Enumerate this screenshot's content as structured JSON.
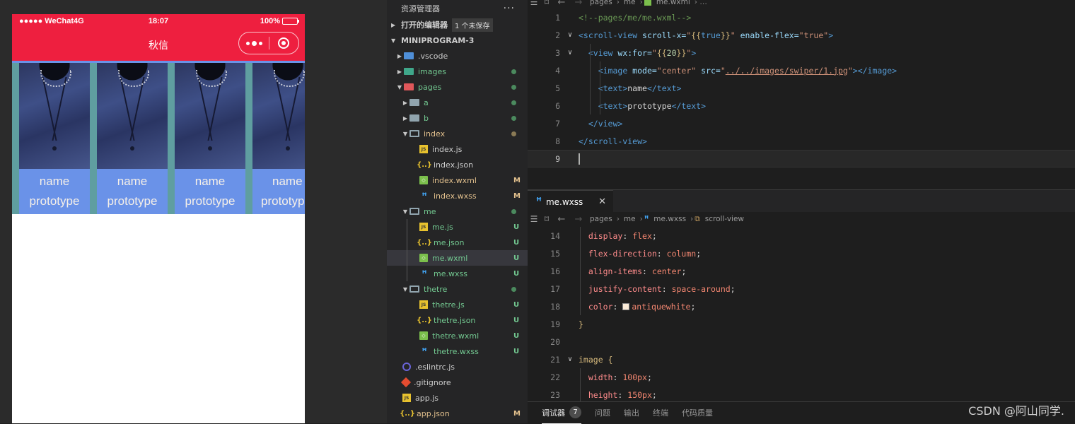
{
  "simulator": {
    "status": {
      "carrier": "●●●●● WeChat4G",
      "time": "18:07",
      "battery": "100%"
    },
    "nav_title": "秋信",
    "items": [
      {
        "name": "name",
        "proto": "prototype"
      },
      {
        "name": "name",
        "proto": "prototype"
      },
      {
        "name": "name",
        "proto": "prototype"
      },
      {
        "name": "name",
        "proto": "prototyp"
      }
    ]
  },
  "explorer": {
    "title": "资源管理器",
    "more": "···",
    "open_editors": "打开的编辑器",
    "unsaved_badge": "1 个未保存",
    "project": "MINIPROGRAM-3",
    "tree": [
      {
        "label": ".vscode",
        "icon": "folder-vs",
        "arrow": "▶",
        "depth": 1,
        "color": "#cccccc"
      },
      {
        "label": "images",
        "icon": "folder-img",
        "arrow": "▶",
        "depth": 1,
        "color": "#73c991",
        "dot": "#4b8a5e"
      },
      {
        "label": "pages",
        "icon": "folder-pg",
        "arrow": "▼",
        "depth": 1,
        "color": "#73c991",
        "dot": "#4b8a5e"
      },
      {
        "label": "a",
        "icon": "folder",
        "arrow": "▶",
        "depth": 2,
        "color": "#73c991",
        "dot": "#4b8a5e"
      },
      {
        "label": "b",
        "icon": "folder",
        "arrow": "▶",
        "depth": 2,
        "color": "#73c991",
        "dot": "#4b8a5e"
      },
      {
        "label": "index",
        "icon": "folder-open",
        "arrow": "▼",
        "depth": 2,
        "color": "#e2c08d",
        "dot": "#8a7a55"
      },
      {
        "label": "index.js",
        "icon": "js",
        "depth": 3,
        "color": "#cccccc"
      },
      {
        "label": "index.json",
        "icon": "json",
        "depth": 3,
        "color": "#cccccc"
      },
      {
        "label": "index.wxml",
        "icon": "wxml",
        "depth": 3,
        "color": "#e2c08d",
        "stat": "M"
      },
      {
        "label": "index.wxss",
        "icon": "wxss",
        "depth": 3,
        "color": "#e2c08d",
        "stat": "M"
      },
      {
        "label": "me",
        "icon": "folder-open",
        "arrow": "▼",
        "depth": 2,
        "color": "#73c991",
        "dot": "#4b8a5e"
      },
      {
        "label": "me.js",
        "icon": "js",
        "depth": 3,
        "color": "#73c991",
        "stat": "U"
      },
      {
        "label": "me.json",
        "icon": "json",
        "depth": 3,
        "color": "#73c991",
        "stat": "U"
      },
      {
        "label": "me.wxml",
        "icon": "wxml",
        "depth": 3,
        "color": "#73c991",
        "stat": "U",
        "selected": true
      },
      {
        "label": "me.wxss",
        "icon": "wxss",
        "depth": 3,
        "color": "#73c991",
        "stat": "U"
      },
      {
        "label": "thetre",
        "icon": "folder-open",
        "arrow": "▼",
        "depth": 2,
        "color": "#73c991",
        "dot": "#4b8a5e"
      },
      {
        "label": "thetre.js",
        "icon": "js",
        "depth": 3,
        "color": "#73c991",
        "stat": "U"
      },
      {
        "label": "thetre.json",
        "icon": "json",
        "depth": 3,
        "color": "#73c991",
        "stat": "U"
      },
      {
        "label": "thetre.wxml",
        "icon": "wxml",
        "depth": 3,
        "color": "#73c991",
        "stat": "U"
      },
      {
        "label": "thetre.wxss",
        "icon": "wxss",
        "depth": 3,
        "color": "#73c991",
        "stat": "U"
      },
      {
        "label": ".eslintrc.js",
        "icon": "eslint",
        "depth": 1,
        "color": "#cccccc"
      },
      {
        "label": ".gitignore",
        "icon": "git",
        "depth": 1,
        "color": "#cccccc"
      },
      {
        "label": "app.js",
        "icon": "js",
        "depth": 1,
        "color": "#cccccc"
      },
      {
        "label": "app.json",
        "icon": "json",
        "depth": 1,
        "color": "#e2c08d",
        "stat": "M"
      }
    ]
  },
  "editor": {
    "top_crumb": {
      "folder": "pages",
      "sub": "me",
      "file": "me.wxml"
    },
    "wxml_lines": [
      {
        "n": "1",
        "fold": ""
      },
      {
        "n": "2",
        "fold": "∨"
      },
      {
        "n": "3",
        "fold": "∨"
      },
      {
        "n": "4",
        "fold": ""
      },
      {
        "n": "5",
        "fold": ""
      },
      {
        "n": "6",
        "fold": ""
      },
      {
        "n": "7",
        "fold": ""
      },
      {
        "n": "8",
        "fold": ""
      },
      {
        "n": "9",
        "fold": ""
      }
    ],
    "wxml": {
      "l1": "<!--pages/me/me.wxml-->",
      "l2_tag": "<scroll-view",
      "l2_a1": " scroll-x=",
      "l2_q1": "\"",
      "l2_b1": "{{",
      "l2_v1": "true",
      "l2_b2": "}}",
      "l2_q2": "\"",
      "l2_a2": " enable-flex=",
      "l2_v2": "\"true\"",
      "l2_end": ">",
      "l3_tag": "<view",
      "l3_a1": " wx:for=",
      "l3_q1": "\"",
      "l3_b1": "{{",
      "l3_v1": "20",
      "l3_b2": "}}",
      "l3_q2": "\"",
      "l3_end": ">",
      "l4_tag": "<image",
      "l4_a1": " mode=",
      "l4_v1": "\"center\"",
      "l4_a2": " src=",
      "l4_q": "\"",
      "l4_link": "../../images/swiper/1.jpg",
      "l4_q2": "\"",
      "l4_end": "></image>",
      "l5_o": "<text>",
      "l5_t": "name",
      "l5_c": "</text>",
      "l6_o": "<text>",
      "l6_t": "prototype",
      "l6_c": "</text>",
      "l7": "</view>",
      "l8": "</scroll-view>"
    },
    "wxss_tab": "me.wxss",
    "wxss_crumb": {
      "folder": "pages",
      "sub": "me",
      "file": "me.wxss",
      "sym": "scroll-view"
    },
    "wxss_lines": [
      {
        "n": "14",
        "fold": "",
        "prop": "display",
        "val": "flex"
      },
      {
        "n": "15",
        "fold": "",
        "prop": "flex-direction",
        "val": "column"
      },
      {
        "n": "16",
        "fold": "",
        "prop": "align-items",
        "val": "center"
      },
      {
        "n": "17",
        "fold": "",
        "prop": "justify-content",
        "val": "space-around"
      },
      {
        "n": "18",
        "fold": "",
        "prop": "color",
        "val": "antiquewhite",
        "swatch": "#faebd7"
      },
      {
        "n": "19",
        "fold": "",
        "close": "}"
      },
      {
        "n": "20",
        "fold": ""
      },
      {
        "n": "21",
        "fold": "∨",
        "sel": "image {"
      },
      {
        "n": "22",
        "fold": "",
        "prop": "width",
        "num": "100px"
      },
      {
        "n": "23",
        "fold": "",
        "prop": "height",
        "num": "150px"
      }
    ]
  },
  "panel": {
    "tabs": [
      "调试器",
      "问题",
      "输出",
      "终端",
      "代码质量"
    ],
    "debug_count": "7"
  },
  "watermark": "CSDN @阿山同学."
}
